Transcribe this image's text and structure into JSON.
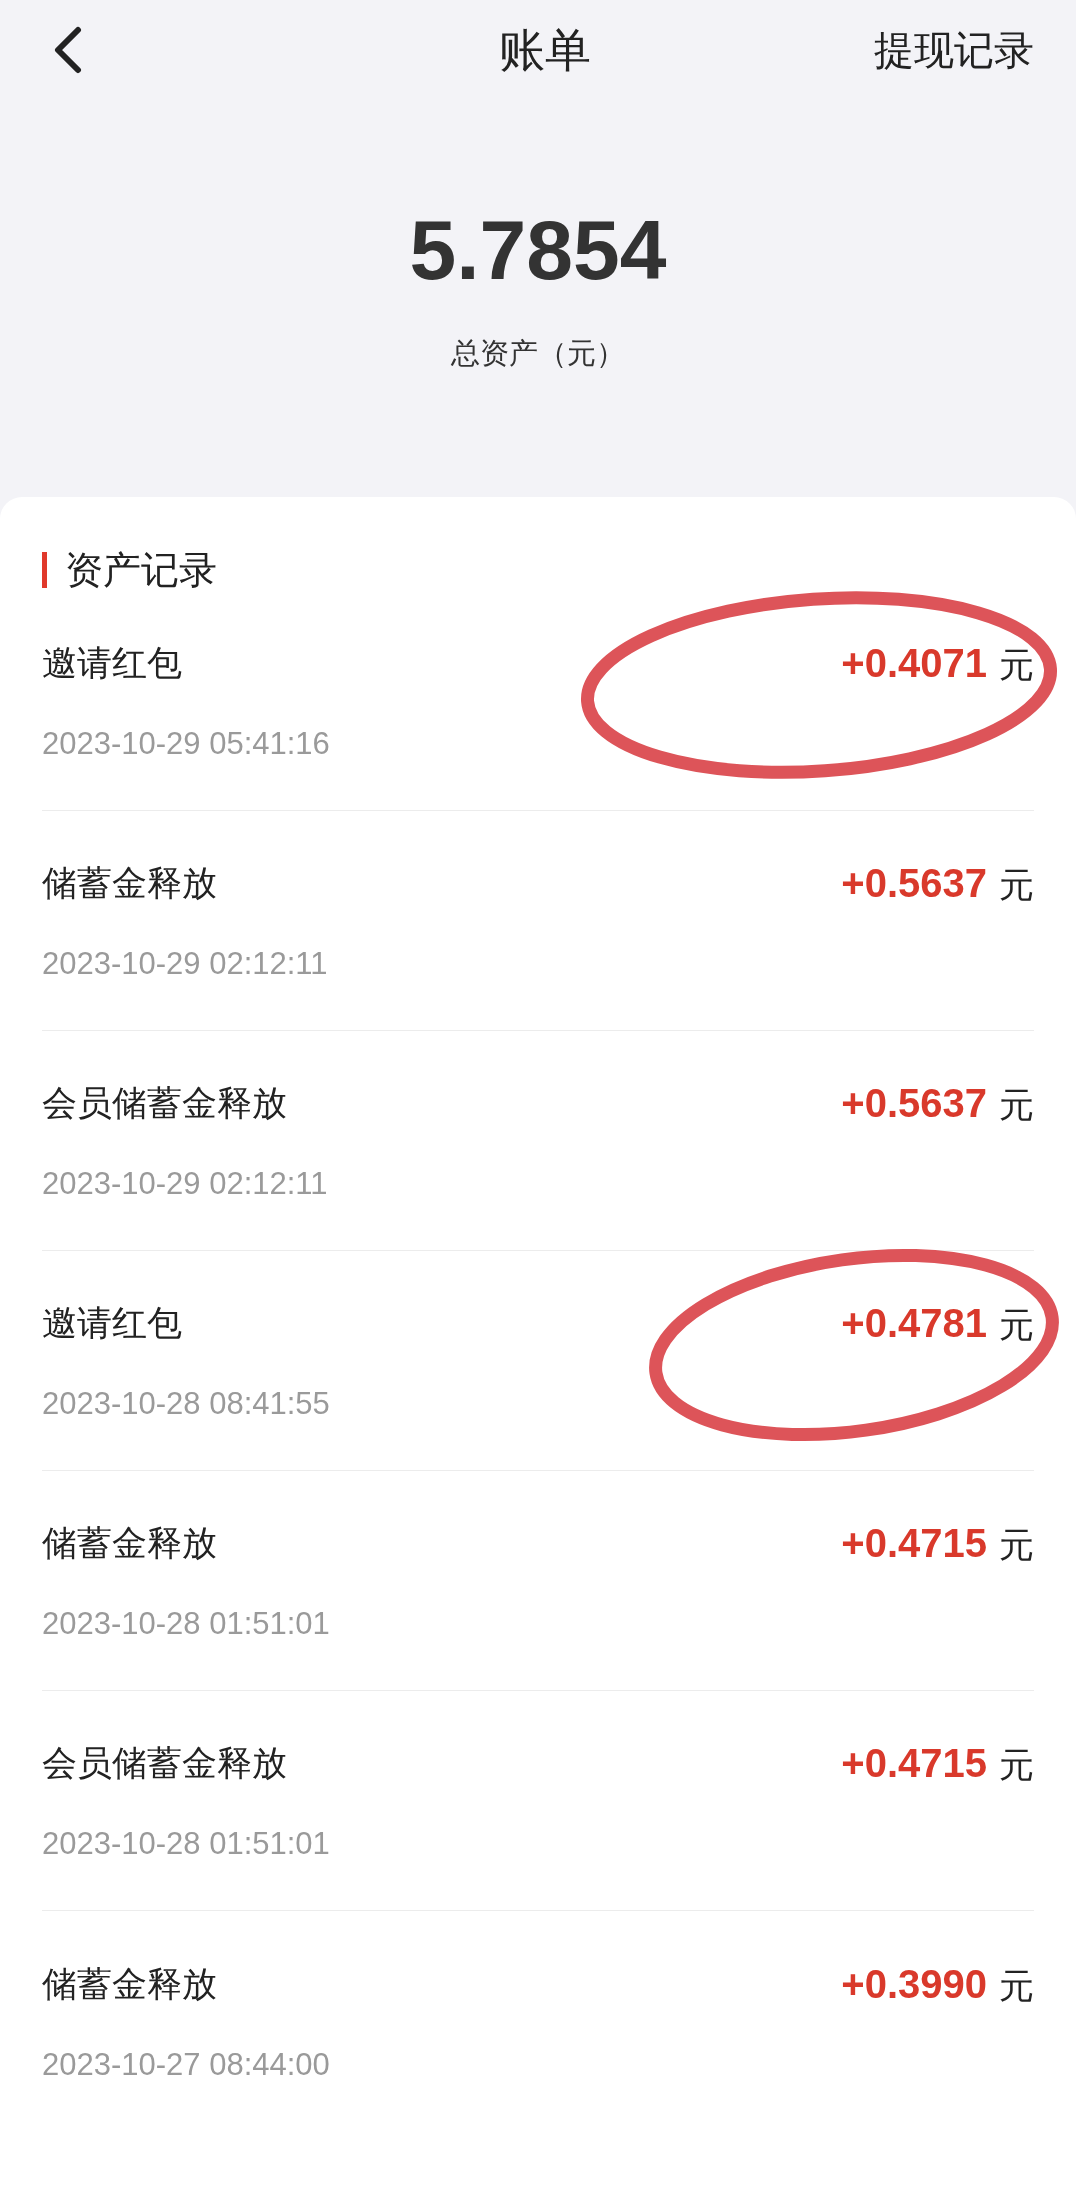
{
  "header": {
    "title": "账单",
    "action": "提现记录"
  },
  "balance": {
    "amount": "5.7854",
    "label": "总资产（元）"
  },
  "section": {
    "title": "资产记录"
  },
  "records": [
    {
      "title": "邀请红包",
      "time": "2023-10-29 05:41:16",
      "amount": "+0.4071",
      "unit": "元",
      "circled": true
    },
    {
      "title": "储蓄金释放",
      "time": "2023-10-29 02:12:11",
      "amount": "+0.5637",
      "unit": "元",
      "circled": false
    },
    {
      "title": "会员储蓄金释放",
      "time": "2023-10-29 02:12:11",
      "amount": "+0.5637",
      "unit": "元",
      "circled": false
    },
    {
      "title": "邀请红包",
      "time": "2023-10-28 08:41:55",
      "amount": "+0.4781",
      "unit": "元",
      "circled": true
    },
    {
      "title": "储蓄金释放",
      "time": "2023-10-28 01:51:01",
      "amount": "+0.4715",
      "unit": "元",
      "circled": false
    },
    {
      "title": "会员储蓄金释放",
      "time": "2023-10-28 01:51:01",
      "amount": "+0.4715",
      "unit": "元",
      "circled": false
    },
    {
      "title": "储蓄金释放",
      "time": "2023-10-27 08:44:00",
      "amount": "+0.3990",
      "unit": "元",
      "circled": false
    }
  ]
}
